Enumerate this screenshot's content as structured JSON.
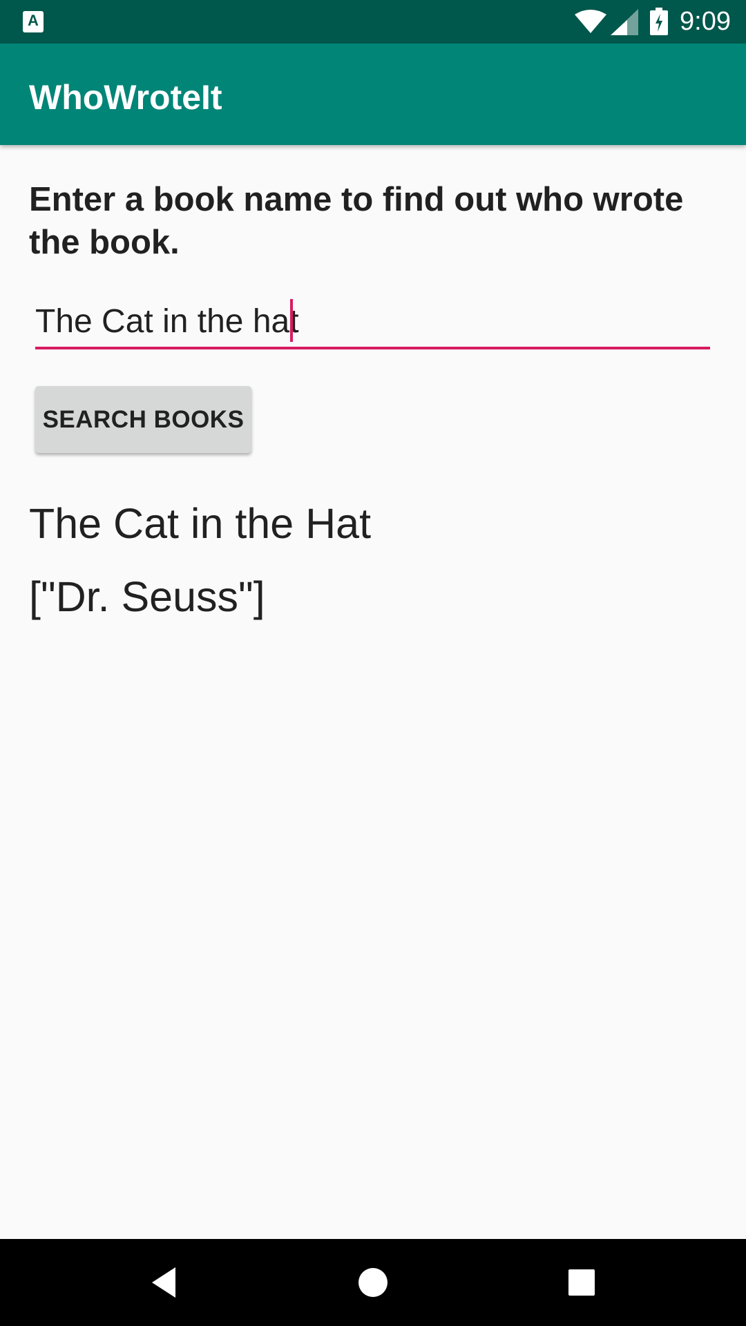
{
  "status_bar": {
    "notification_icon": "text-input-notification-icon",
    "notification_glyph": "A",
    "icons": [
      "wifi-icon",
      "signal-icon",
      "battery-charging-icon"
    ],
    "time": "9:09",
    "background_color": "#00574B"
  },
  "app_bar": {
    "title": "WhoWroteIt",
    "background_color": "#008577"
  },
  "main": {
    "prompt": "Enter a book name to find out who wrote the book.",
    "book_input": {
      "value": "The Cat in the hat",
      "accent_color": "#D81B60"
    },
    "search_button_label": "SEARCH BOOKS",
    "result_title": "The Cat in the Hat",
    "result_author": "[\"Dr. Seuss\"]"
  },
  "nav_bar": {
    "icons": [
      "back-icon",
      "home-icon",
      "recents-icon"
    ]
  }
}
